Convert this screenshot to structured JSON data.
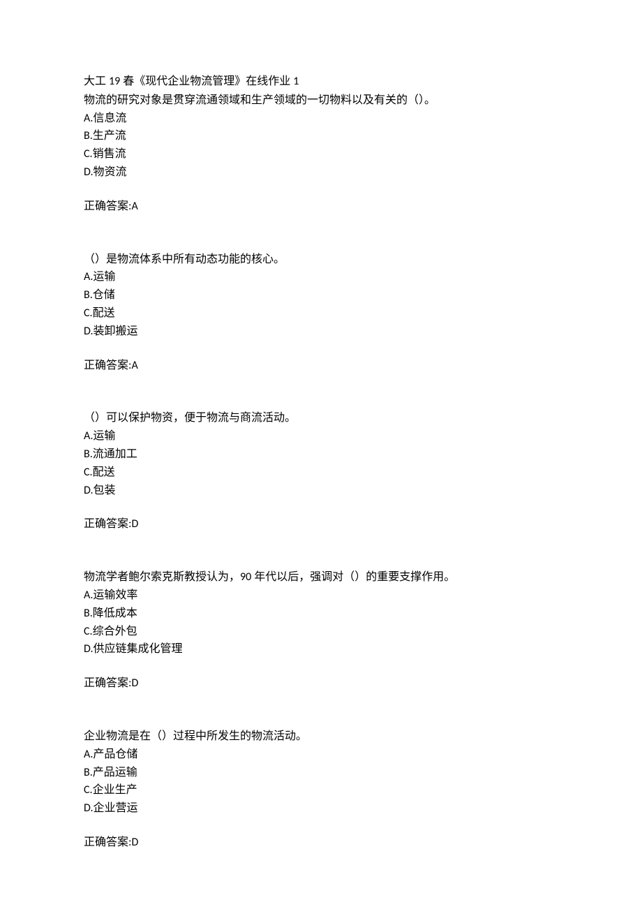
{
  "header": {
    "prefix": "大工 ",
    "num1": "19",
    "mid": " 春《现代企业物流管理》在线作业 ",
    "num2": "1"
  },
  "questions": [
    {
      "text": "物流的研究对象是贯穿流通领域和生产领域的一切物料以及有关的（）。",
      "options": [
        {
          "letter": "A",
          "text": "信息流"
        },
        {
          "letter": "B",
          "text": "生产流"
        },
        {
          "letter": "C",
          "text": "销售流"
        },
        {
          "letter": "D",
          "text": "物资流"
        }
      ],
      "answer_label": "正确答案:",
      "answer_value": "A"
    },
    {
      "text": "（）是物流体系中所有动态功能的核心。",
      "options": [
        {
          "letter": "A",
          "text": "运输"
        },
        {
          "letter": "B",
          "text": "仓储"
        },
        {
          "letter": "C",
          "text": "配送"
        },
        {
          "letter": "D",
          "text": "装卸搬运"
        }
      ],
      "answer_label": "正确答案:",
      "answer_value": "A"
    },
    {
      "text": "（）可以保护物资，便于物流与商流活动。",
      "options": [
        {
          "letter": "A",
          "text": "运输"
        },
        {
          "letter": "B",
          "text": "流通加工"
        },
        {
          "letter": "C",
          "text": "配送"
        },
        {
          "letter": "D",
          "text": "包装"
        }
      ],
      "answer_label": "正确答案:",
      "answer_value": "D"
    },
    {
      "text_pre": "物流学者鲍尔索克斯教授认为，",
      "text_num": "90",
      "text_post": " 年代以后，强调对（）的重要支撑作用。",
      "options": [
        {
          "letter": "A",
          "text": "运输效率"
        },
        {
          "letter": "B",
          "text": "降低成本"
        },
        {
          "letter": "C",
          "text": "综合外包"
        },
        {
          "letter": "D",
          "text": "供应链集成化管理"
        }
      ],
      "answer_label": "正确答案:",
      "answer_value": "D"
    },
    {
      "text": "企业物流是在（）过程中所发生的物流活动。",
      "options": [
        {
          "letter": "A",
          "text": "产品仓储"
        },
        {
          "letter": "B",
          "text": "产品运输"
        },
        {
          "letter": "C",
          "text": "企业生产"
        },
        {
          "letter": "D",
          "text": "企业营运"
        }
      ],
      "answer_label": "正确答案:",
      "answer_value": "D"
    }
  ]
}
